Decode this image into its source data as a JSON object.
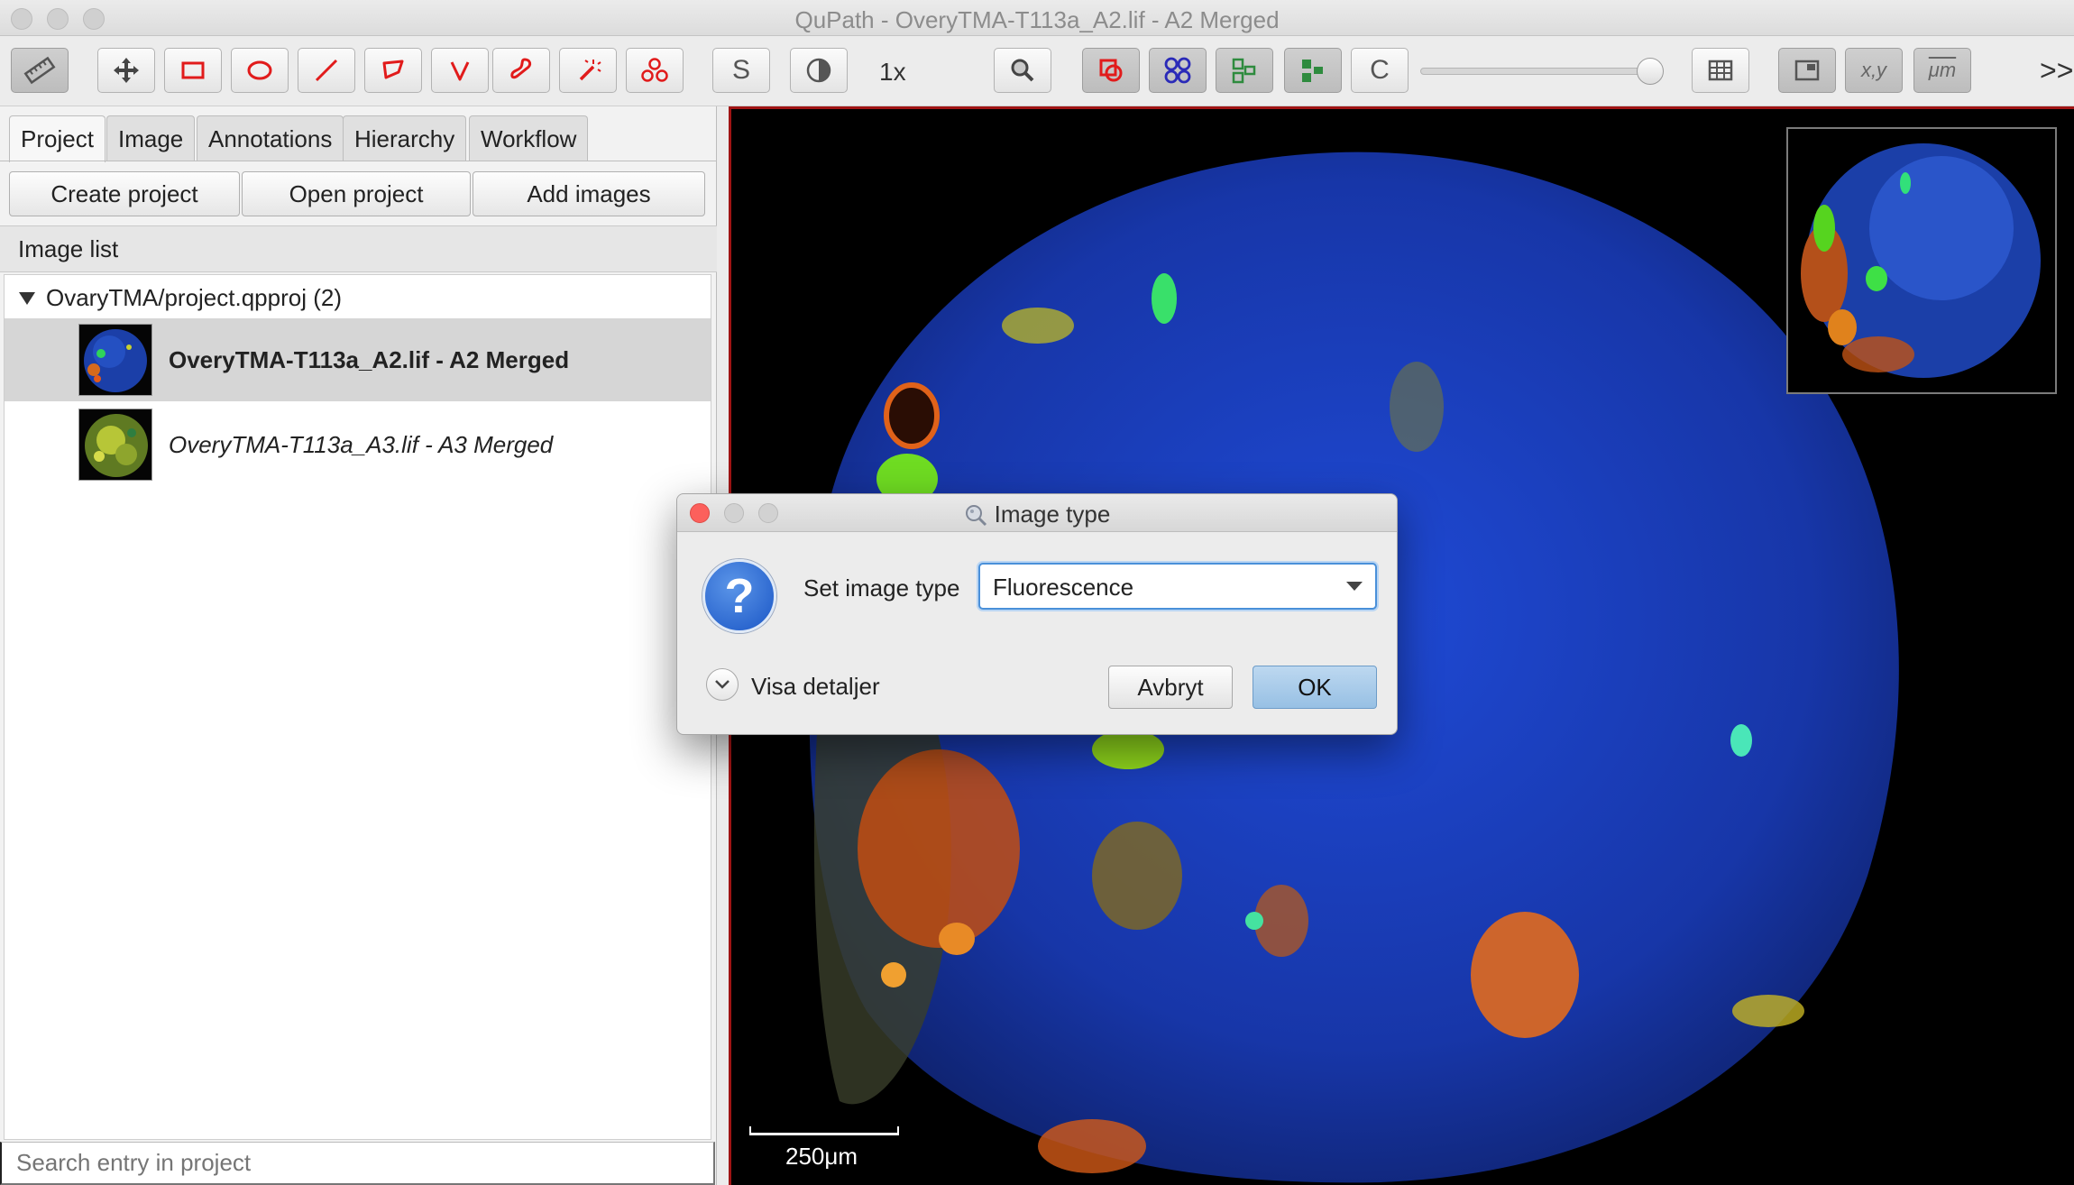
{
  "window": {
    "title": "QuPath - OveryTMA-T113a_A2.lif - A2 Merged"
  },
  "toolbar": {
    "zoom_label": "1x",
    "s_label": "S",
    "c_label": "C",
    "xy_label": "x,y",
    "um_label": "μm",
    "overflow_label": ">>",
    "slider_value": 1.0,
    "tool_color": "#e11b1b",
    "icons": [
      "ruler-icon",
      "move-icon",
      "rectangle-icon",
      "ellipse-icon",
      "line-icon",
      "polygon-icon",
      "polyline-icon",
      "brush-icon",
      "wand-icon",
      "points-icon",
      "contrast-icon",
      "magnifier-icon",
      "annotations-icon",
      "tma-grid-icon",
      "detections-icon",
      "cells-icon",
      "table-icon",
      "overview-icon"
    ]
  },
  "left_panel": {
    "tabs": [
      {
        "label": "Project",
        "active": true
      },
      {
        "label": "Image",
        "active": false
      },
      {
        "label": "Annotations",
        "active": false
      },
      {
        "label": "Hierarchy",
        "active": false
      },
      {
        "label": "Workflow",
        "active": false
      }
    ],
    "buttons": {
      "create": "Create project",
      "open": "Open project",
      "add": "Add images"
    },
    "image_list_header": "Image list",
    "tree_root": "OvaryTMA/project.qpproj (2)",
    "entries": [
      {
        "label": "OveryTMA-T113a_A2.lif - A2 Merged",
        "selected": true
      },
      {
        "label": "OveryTMA-T113a_A3.lif - A3 Merged",
        "selected": false
      }
    ],
    "search_placeholder": "Search entry in project"
  },
  "viewer": {
    "scalebar_label": "250μm",
    "border_color": "#a01414"
  },
  "dialog": {
    "title": "Image type",
    "set_type_label": "Set image type",
    "selected_type": "Fluorescence",
    "details_label": "Visa detaljer",
    "cancel_label": "Avbryt",
    "ok_label": "OK",
    "accent_color": "#4a90d9"
  }
}
